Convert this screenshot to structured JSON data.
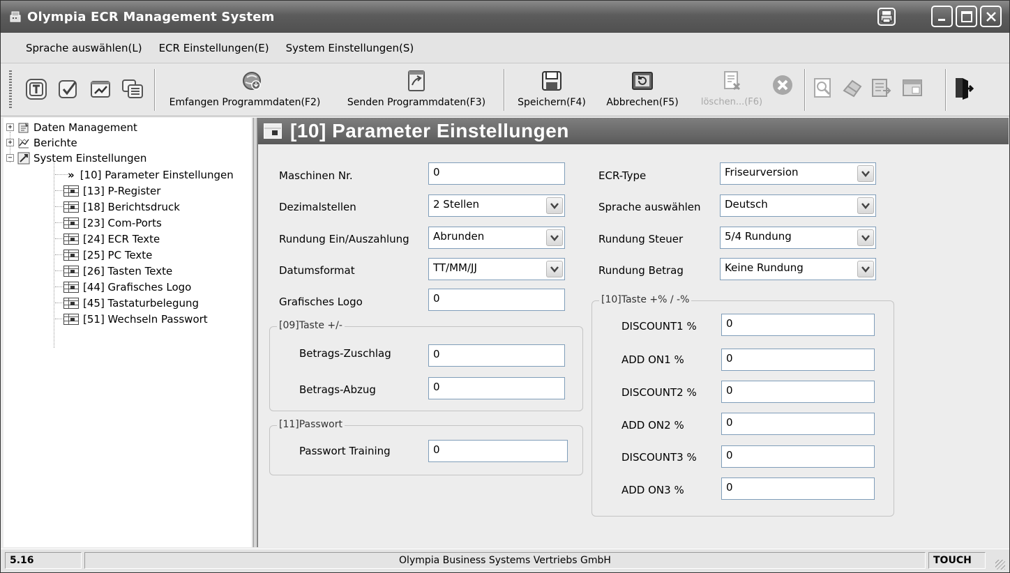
{
  "window": {
    "title": "Olympia ECR Management System"
  },
  "menu": [
    {
      "label": "Sprache auswählen(L)"
    },
    {
      "label": "ECR Einstellungen(E)"
    },
    {
      "label": "System Einstellungen(S)"
    }
  ],
  "toolbar": {
    "receive": "Emfangen Programmdaten(F2)",
    "send": "Senden Programmdaten(F3)",
    "save": "Speichern(F4)",
    "cancel": "Abbrechen(F5)",
    "delete": "löschen...(F6)"
  },
  "tree": {
    "root1": "Daten Management",
    "root2": "Berichte",
    "root3": "System Einstellungen",
    "current_marker": "»",
    "children": [
      "[10] Parameter Einstellungen",
      "[13] P-Register",
      "[18] Berichtsdruck",
      "[23] Com-Ports",
      "[24] ECR Texte",
      "[25] PC Texte",
      "[26] Tasten Texte",
      "[44] Grafisches Logo",
      "[45] Tastaturbelegung",
      "[51] Wechseln Passwort"
    ]
  },
  "panel": {
    "title": "[10] Parameter Einstellungen",
    "left": {
      "maschinen_nr": {
        "label": "Maschinen Nr.",
        "value": "0"
      },
      "dezimalstellen": {
        "label": "Dezimalstellen",
        "value": "2 Stellen"
      },
      "rundung_ein": {
        "label": "Rundung Ein/Auszahlung",
        "value": "Abrunden"
      },
      "datumsformat": {
        "label": "Datumsformat",
        "value": "TT/MM/JJ"
      },
      "grafisches_logo": {
        "label": "Grafisches Logo",
        "value": "0"
      }
    },
    "group09": {
      "title": "[09]Taste +/-",
      "zuschlag": {
        "label": "Betrags-Zuschlag",
        "value": "0"
      },
      "abzug": {
        "label": "Betrags-Abzug",
        "value": "0"
      }
    },
    "group11": {
      "title": "[11]Passwort",
      "training": {
        "label": "Passwort Training",
        "value": "0"
      }
    },
    "right": {
      "ecr_type": {
        "label": "ECR-Type",
        "value": "Friseurversion"
      },
      "sprache": {
        "label": "Sprache auswählen",
        "value": "Deutsch"
      },
      "rundung_steuer": {
        "label": "Rundung Steuer",
        "value": "5/4 Rundung"
      },
      "rundung_betrag": {
        "label": "Rundung Betrag",
        "value": "Keine Rundung"
      }
    },
    "group10": {
      "title": "[10]Taste +% / -%",
      "rows": [
        {
          "label": "DISCOUNT1 %",
          "value": "0"
        },
        {
          "label": "ADD ON1 %",
          "value": "0"
        },
        {
          "label": "DISCOUNT2 %",
          "value": "0"
        },
        {
          "label": "ADD ON2 %",
          "value": "0"
        },
        {
          "label": "DISCOUNT3 %",
          "value": "0"
        },
        {
          "label": "ADD ON3 %",
          "value": "0"
        }
      ]
    }
  },
  "status": {
    "version": "5.16",
    "company": "Olympia Business Systems Vertriebs GmbH",
    "mode": "TOUCH"
  }
}
